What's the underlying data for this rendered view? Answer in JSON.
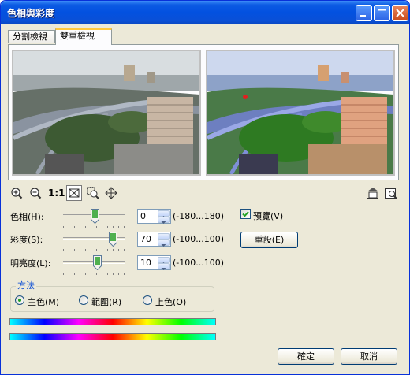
{
  "window": {
    "title": "色相與彩度"
  },
  "tabs": [
    {
      "label": "分割檢視"
    },
    {
      "label": "雙重檢視"
    }
  ],
  "toolbar": {
    "zoom_fit_label": "1:1"
  },
  "controls": {
    "hue": {
      "label": "色相(H):",
      "value": "0",
      "range": "(-180...180)"
    },
    "saturation": {
      "label": "彩度(S):",
      "value": "70",
      "range": "(-100...100)"
    },
    "lightness": {
      "label": "明亮度(L):",
      "value": "10",
      "range": "(-100...100)"
    }
  },
  "preview": {
    "label": "預覽(V)",
    "checked": true
  },
  "reset_label": "重設(E)",
  "method": {
    "caption": "方法",
    "options": [
      {
        "label": "主色(M)",
        "selected": true
      },
      {
        "label": "範圍(R)",
        "selected": false
      },
      {
        "label": "上色(O)",
        "selected": false
      }
    ]
  },
  "buttons": {
    "ok": "確定",
    "cancel": "取消"
  }
}
